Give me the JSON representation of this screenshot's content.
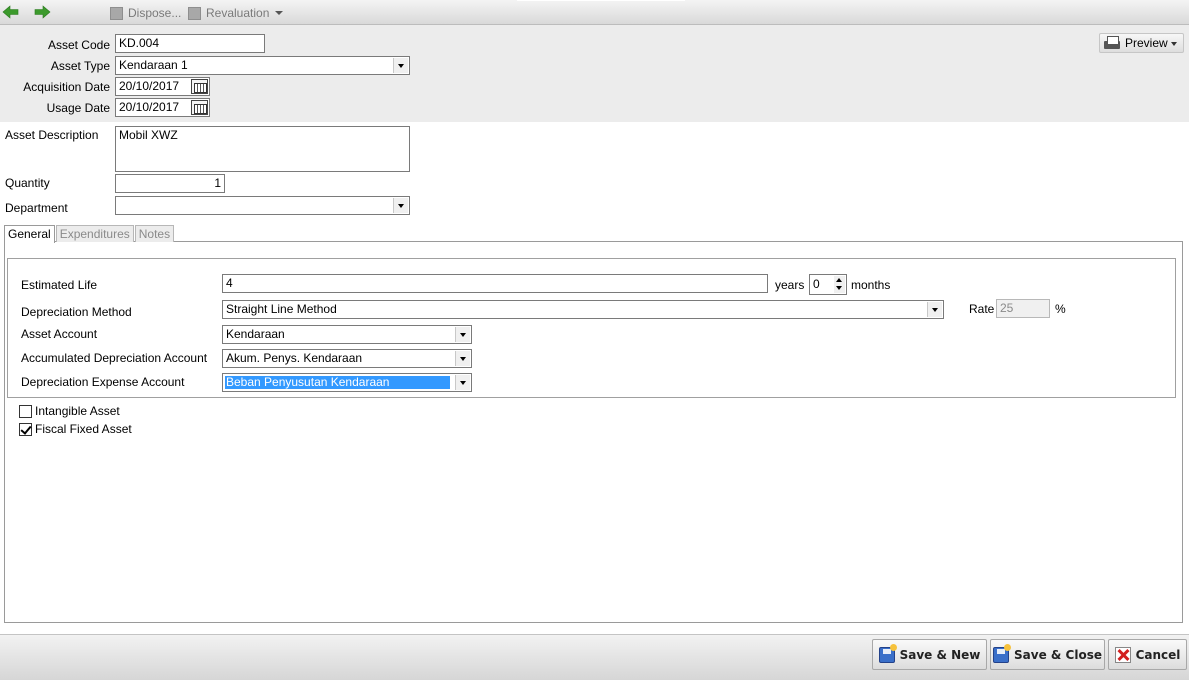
{
  "toolbar": {
    "dispose_label": "Dispose...",
    "revaluation_label": "Revaluation",
    "back_icon": "arrow-left-icon",
    "forward_icon": "arrow-right-icon"
  },
  "header": {
    "asset_code_label": "Asset Code",
    "asset_code_value": "KD.004",
    "asset_type_label": "Asset Type",
    "asset_type_value": "Kendaraan 1",
    "acquisition_date_label": "Acquisition Date",
    "acquisition_date_value": "20/10/2017",
    "usage_date_label": "Usage Date",
    "usage_date_value": "20/10/2017",
    "preview_label": "Preview"
  },
  "main": {
    "asset_description_label": "Asset Description",
    "asset_description_value": "Mobil XWZ",
    "quantity_label": "Quantity",
    "quantity_value": "1",
    "department_label": "Department",
    "department_value": ""
  },
  "tabs": [
    {
      "label": "General"
    },
    {
      "label": "Expenditures"
    },
    {
      "label": "Notes"
    }
  ],
  "general": {
    "estimated_life_label": "Estimated Life",
    "estimated_life_value": "4",
    "years_label": "years",
    "months_value": "0",
    "months_label": "months",
    "depreciation_method_label": "Depreciation Method",
    "depreciation_method_value": "Straight Line Method",
    "rate_label": "Rate",
    "rate_value": "25",
    "rate_unit": "%",
    "asset_account_label": "Asset Account",
    "asset_account_value": "Kendaraan",
    "accum_dep_label": "Accumulated Depreciation Account",
    "accum_dep_value": "Akum. Penys. Kendaraan",
    "dep_expense_label": "Depreciation Expense Account",
    "dep_expense_value": "Beban Penyusutan Kendaraan",
    "intangible_label": "Intangible Asset",
    "intangible_checked": false,
    "fiscal_label": "Fiscal Fixed Asset",
    "fiscal_checked": true
  },
  "actions": {
    "save_new_label": "Save & New",
    "save_close_label": "Save & Close",
    "cancel_label": "Cancel"
  },
  "colors": {
    "selection": "#3399ff",
    "back_arrow": "#3c9a2c",
    "cancel_x": "#d21f1f"
  }
}
